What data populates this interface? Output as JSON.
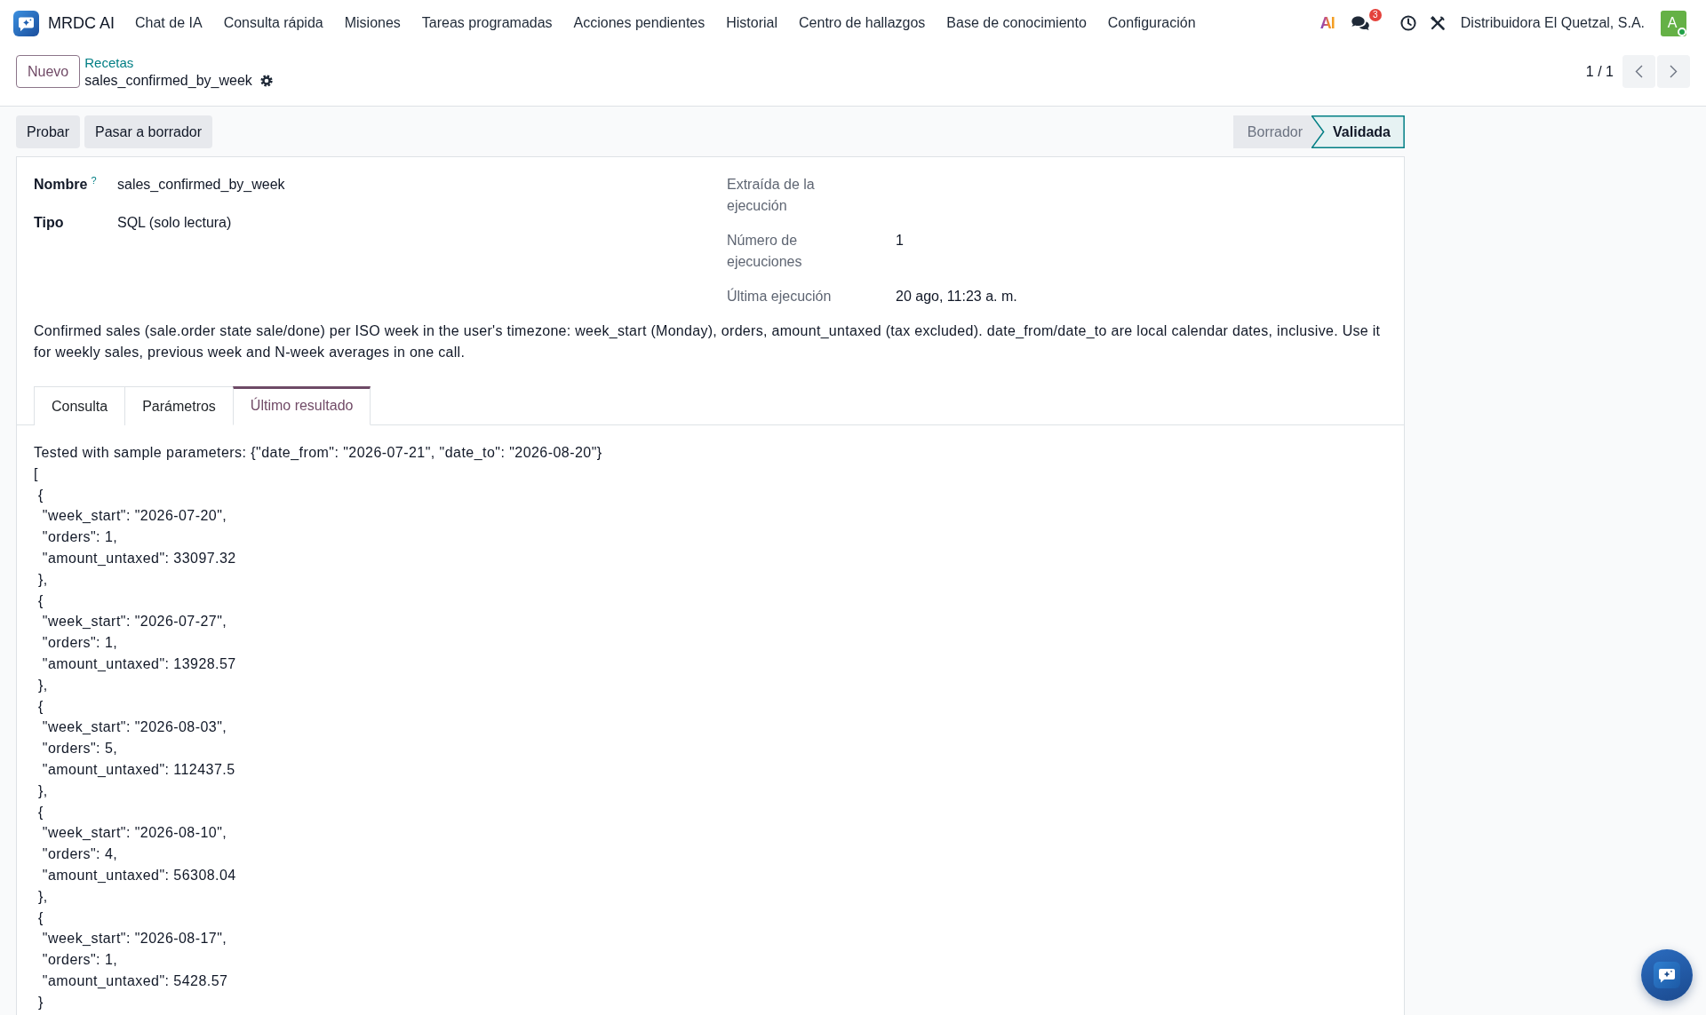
{
  "navbar": {
    "brand": "MRDC AI",
    "menu": [
      "Chat de IA",
      "Consulta rápida",
      "Misiones",
      "Tareas programadas",
      "Acciones pendientes",
      "Historial",
      "Centro de hallazgos",
      "Base de conocimiento",
      "Configuración"
    ],
    "ai_mark": "AI",
    "messages_badge": "3",
    "company": "Distribuidora El Quetzal, S.A.",
    "avatar": {
      "initial": "A",
      "online": true
    }
  },
  "control_panel": {
    "new_button": "Nuevo",
    "breadcrumb": "Recetas",
    "record_name": "sales_confirmed_by_week",
    "pager": "1 / 1"
  },
  "actions": [
    "Probar",
    "Pasar a borrador"
  ],
  "status_bar": [
    {
      "label": "Borrador",
      "selected": false
    },
    {
      "label": "Validada",
      "selected": true
    }
  ],
  "form": {
    "left_fields": [
      {
        "label": "Nombre",
        "help": "?",
        "value": "sales_confirmed_by_week"
      },
      {
        "label": "Tipo",
        "value": "SQL (solo lectura)"
      }
    ],
    "right_fields": [
      {
        "label": "Extraída de la ejecución"
      },
      {
        "label": "Número de ejecuciones",
        "value": "1"
      },
      {
        "label": "Última ejecución",
        "value": "20 ago, 11:23 a. m."
      }
    ],
    "description": "Confirmed sales (sale.order state sale/done) per ISO week in the user's timezone: week_start (Monday), orders, amount_untaxed (tax excluded). date_from/date_to are local calendar dates, inclusive. Use it for weekly sales, previous week and N-week averages in one call.",
    "tabs": [
      {
        "label": "Consulta",
        "selected": false
      },
      {
        "label": "Parámetros",
        "selected": false
      },
      {
        "label": "Último resultado",
        "selected": true
      }
    ],
    "result": "Tested with sample parameters: {\"date_from\": \"2026-07-21\", \"date_to\": \"2026-08-20\"}\n[\n {\n  \"week_start\": \"2026-07-20\",\n  \"orders\": 1,\n  \"amount_untaxed\": 33097.32\n },\n {\n  \"week_start\": \"2026-07-27\",\n  \"orders\": 1,\n  \"amount_untaxed\": 13928.57\n },\n {\n  \"week_start\": \"2026-08-03\",\n  \"orders\": 5,\n  \"amount_untaxed\": 112437.5\n },\n {\n  \"week_start\": \"2026-08-10\",\n  \"orders\": 4,\n  \"amount_untaxed\": 56308.04\n },\n {\n  \"week_start\": \"2026-08-17\",\n  \"orders\": 1,\n  \"amount_untaxed\": 5428.57\n }"
  }
}
